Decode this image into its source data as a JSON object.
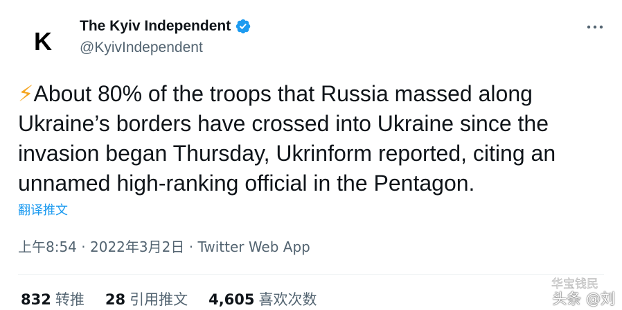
{
  "author": {
    "avatar_letter": "K",
    "display_name": "The Kyiv Independent",
    "handle": "@KyivIndependent",
    "verified_icon": "verified-badge-icon",
    "verified_color": "#1d9bf0"
  },
  "tweet": {
    "emoji": "⚡",
    "line1": "About 80% of the troops that Russia massed along",
    "line2": "Ukraine’s borders have crossed into Ukraine since the",
    "line3": "invasion began Thursday, Ukrinform reported, citing an",
    "line4": "unnamed high-ranking official in the Pentagon."
  },
  "translate_label": "翻译推文",
  "meta": {
    "time": "上午8:54",
    "sep1": " · ",
    "date": "2022年3月2日",
    "sep2": " · ",
    "app": "Twitter Web App"
  },
  "stats": {
    "retweets_count": "832",
    "retweets_label": "转推",
    "quotes_count": "28",
    "quotes_label": "引用推文",
    "likes_count": "4,605",
    "likes_label": "喜欢次数"
  },
  "watermark": {
    "text": "头条 @刘",
    "mark_text": "华宝钱民"
  },
  "colors": {
    "text": "#0f1419",
    "secondary": "#536471",
    "accent": "#1d9bf0"
  }
}
